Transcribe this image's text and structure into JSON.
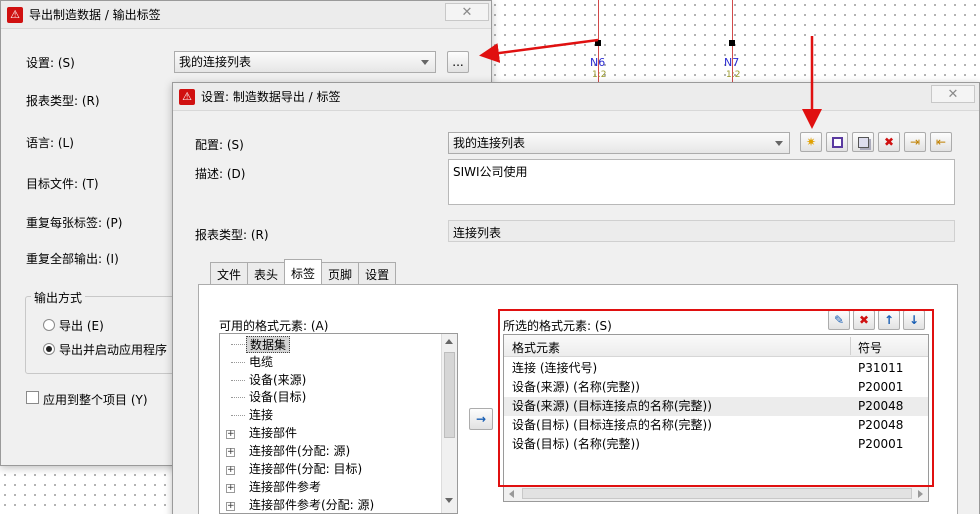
{
  "canvas": {
    "nodes": [
      {
        "label": "N6",
        "sub": "1:2"
      },
      {
        "label": "N7",
        "sub": "1:2"
      }
    ]
  },
  "back_dialog": {
    "title": "导出制造数据 / 输出标签",
    "close_icon": "✕",
    "settings_label": "设置: (S)",
    "settings_value": "我的连接列表",
    "more_button": "...",
    "report_type_label": "报表类型: (R)",
    "language_label": "语言: (L)",
    "target_file_label": "目标文件: (T)",
    "repeat_each_label": "重复每张标签: (P)",
    "repeat_all_label": "重复全部输出: (I)",
    "output_group_label": "输出方式",
    "output_export": "导出 (E)",
    "output_export_launch": "导出并启动应用程序",
    "apply_all": "应用到整个项目 (Y)"
  },
  "front_dialog": {
    "title": "设置: 制造数据导出 / 标签",
    "close_icon": "✕",
    "config_label": "配置: (S)",
    "config_value": "我的连接列表",
    "desc_label": "描述: (D)",
    "desc_value": "SIWI公司使用",
    "report_type_label": "报表类型: (R)",
    "report_type_value": "连接列表",
    "toolbar_icons": [
      "new-icon",
      "save-icon",
      "copy-icon",
      "delete-icon",
      "import-icon",
      "export-icon"
    ],
    "tabs": [
      {
        "label": "文件",
        "active": false
      },
      {
        "label": "表头",
        "active": false
      },
      {
        "label": "标签",
        "active": true
      },
      {
        "label": "页脚",
        "active": false
      },
      {
        "label": "设置",
        "active": false
      }
    ],
    "available_label": "可用的格式元素: (A)",
    "available_items": [
      {
        "label": "数据集",
        "expandable": false,
        "selected": true
      },
      {
        "label": "电缆",
        "expandable": false,
        "selected": false
      },
      {
        "label": "设备(来源)",
        "expandable": false,
        "selected": false
      },
      {
        "label": "设备(目标)",
        "expandable": false,
        "selected": false
      },
      {
        "label": "连接",
        "expandable": false,
        "selected": false
      },
      {
        "label": "连接部件",
        "expandable": true,
        "selected": false
      },
      {
        "label": "连接部件(分配: 源)",
        "expandable": true,
        "selected": false
      },
      {
        "label": "连接部件(分配: 目标)",
        "expandable": true,
        "selected": false
      },
      {
        "label": "连接部件参考",
        "expandable": true,
        "selected": false
      },
      {
        "label": "连接部件参考(分配: 源)",
        "expandable": true,
        "selected": false
      }
    ],
    "move_right_icon": "→",
    "selected_label": "所选的格式元素: (S)",
    "selected_toolbar_icons": [
      "edit-icon",
      "delete-icon",
      "move-up-icon",
      "move-down-icon"
    ],
    "grid_headers": {
      "element": "格式元素",
      "symbol": "符号"
    },
    "grid_rows": [
      {
        "element": "连接 (连接代号)",
        "symbol": "P31011"
      },
      {
        "element": "设备(来源) (名称(完整))",
        "symbol": "P20001"
      },
      {
        "element": "设备(来源) (目标连接点的名称(完整))",
        "symbol": "P20048"
      },
      {
        "element": "设备(目标) (目标连接点的名称(完整))",
        "symbol": "P20048"
      },
      {
        "element": "设备(目标) (名称(完整))",
        "symbol": "P20001"
      }
    ]
  },
  "colors": {
    "annotation_red": "#e01010",
    "node_blue": "#2a2ad0",
    "dialog_bg": "#f0f0f0"
  }
}
